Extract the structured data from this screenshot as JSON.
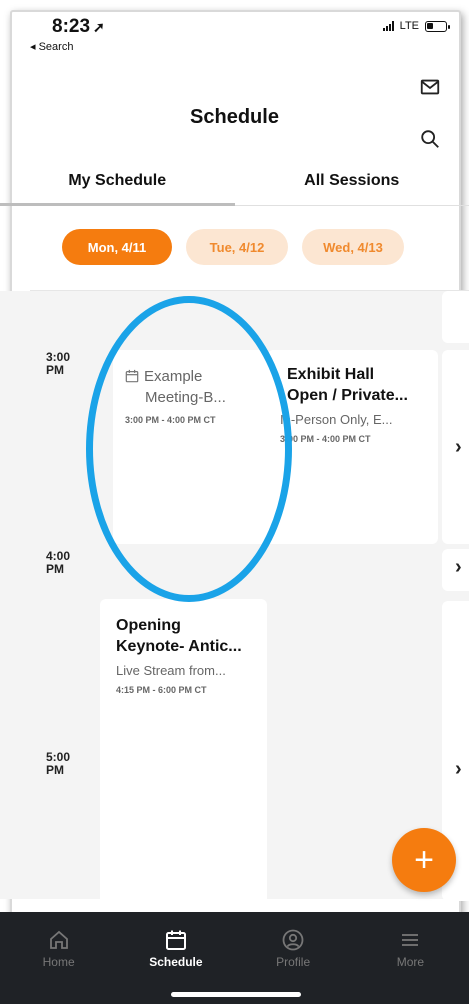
{
  "status_bar": {
    "time": "8:23",
    "back_label": "◂ Search",
    "carrier": "LTE"
  },
  "header": {
    "title": "Schedule"
  },
  "tabs": [
    {
      "label": "My Schedule",
      "active": true
    },
    {
      "label": "All Sessions",
      "active": false
    }
  ],
  "dates": [
    {
      "label": "Mon, 4/11",
      "active": true
    },
    {
      "label": "Tue, 4/12",
      "active": false
    },
    {
      "label": "Wed, 4/13",
      "active": false
    }
  ],
  "time_labels": [
    "3:00\nPM",
    "4:00\nPM",
    "5:00\nPM"
  ],
  "sessions": {
    "meeting": {
      "title_line1": "Example",
      "title_line2": "Meeting-B...",
      "time": "3:00 PM - 4:00 PM CT"
    },
    "exhibit": {
      "title_line1": "Exhibit Hall",
      "title_line2": "Open / Private...",
      "subtitle": "In-Person Only, E...",
      "time": "3:00 PM - 4:00 PM CT"
    },
    "keynote": {
      "title_line1": "Opening",
      "title_line2": "Keynote- Antic...",
      "subtitle": "Live Stream from...",
      "time": "4:15 PM - 6:00 PM CT"
    }
  },
  "fab": {
    "label": "+"
  },
  "tabbar": [
    {
      "label": "Home",
      "icon": "home-icon",
      "active": false
    },
    {
      "label": "Schedule",
      "icon": "calendar-icon",
      "active": true
    },
    {
      "label": "Profile",
      "icon": "profile-icon",
      "active": false
    },
    {
      "label": "More",
      "icon": "menu-icon",
      "active": false
    }
  ],
  "colors": {
    "accent": "#f57c0f",
    "accent_light": "#fce6d2",
    "highlight": "#1aa3e8",
    "tabbar_bg": "#1f2226"
  }
}
